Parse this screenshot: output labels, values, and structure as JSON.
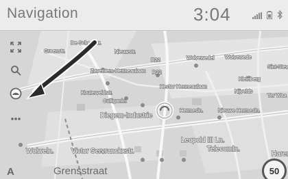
{
  "header": {
    "title": "Navigation",
    "clock": "3:04",
    "status_icons": [
      "signal-bars-icon",
      "battery-icon",
      "bluetooth-icon"
    ]
  },
  "toolbar": {
    "buttons": [
      {
        "name": "expand-icon"
      },
      {
        "name": "search-icon"
      },
      {
        "name": "orientation-icon"
      },
      {
        "name": "more-options-icon"
      }
    ]
  },
  "map": {
    "labels": [
      "De Schoolstr.",
      "Groenstr.",
      "Nieuwstr.",
      "R22",
      "Wolvewedel",
      "Wolvewede",
      "Sint-Steve",
      "Zaventem-Henneaulaan",
      "R22",
      "Kleinberg",
      "Hector Henneaulaan",
      "Kouterveldstr.",
      "Culliganln.",
      "Nijvelds",
      "Ter Waa",
      "Hermesln.",
      "Nieuwe Hermesln.",
      "Diegem-Industrie",
      "Leopold III Ln.",
      "Wolweln.",
      "Victor Servranckxstr.",
      "Telecomln.",
      "Haren"
    ]
  },
  "bottom": {
    "letter": "A",
    "street": "Grensstraat",
    "speed": "50"
  }
}
